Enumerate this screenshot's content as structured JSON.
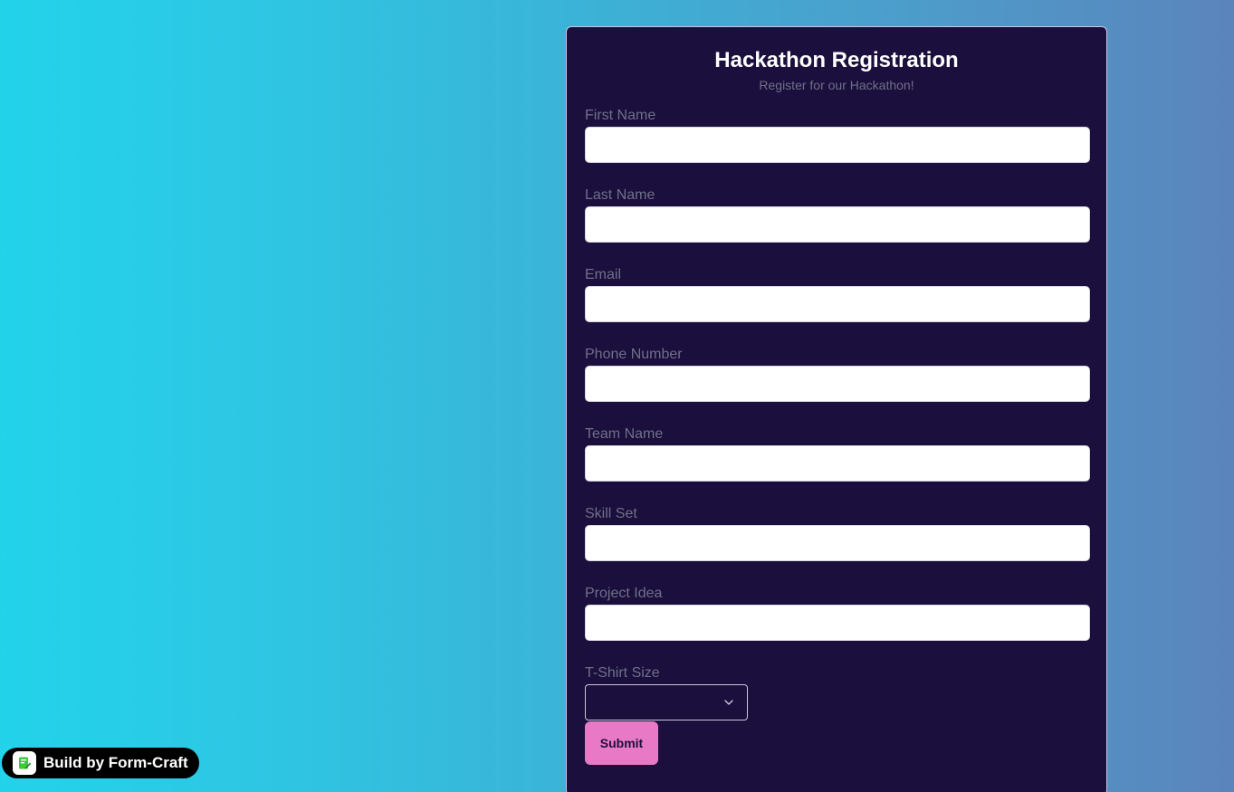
{
  "form": {
    "title": "Hackathon Registration",
    "subtitle": "Register for our Hackathon!",
    "fields": [
      {
        "label": "First Name",
        "value": "",
        "placeholder": ""
      },
      {
        "label": "Last Name",
        "value": "",
        "placeholder": ""
      },
      {
        "label": "Email",
        "value": "",
        "placeholder": ""
      },
      {
        "label": "Phone Number",
        "value": "",
        "placeholder": ""
      },
      {
        "label": "Team Name",
        "value": "",
        "placeholder": ""
      },
      {
        "label": "Skill Set",
        "value": "",
        "placeholder": ""
      },
      {
        "label": "Project Idea",
        "value": "",
        "placeholder": ""
      }
    ],
    "tshirt": {
      "label": "T-Shirt Size",
      "selected": "",
      "icon": "chevron-down-icon"
    },
    "submit_label": "Submit"
  },
  "badge": {
    "text": "Build by Form-Craft",
    "icon": "form-craft-logo-icon"
  },
  "colors": {
    "card_background": "#1b0f3d",
    "label_text": "#6f7189",
    "submit_button": "#e879c6",
    "badge_background": "#000000",
    "logo_green": "#3cc93c"
  }
}
